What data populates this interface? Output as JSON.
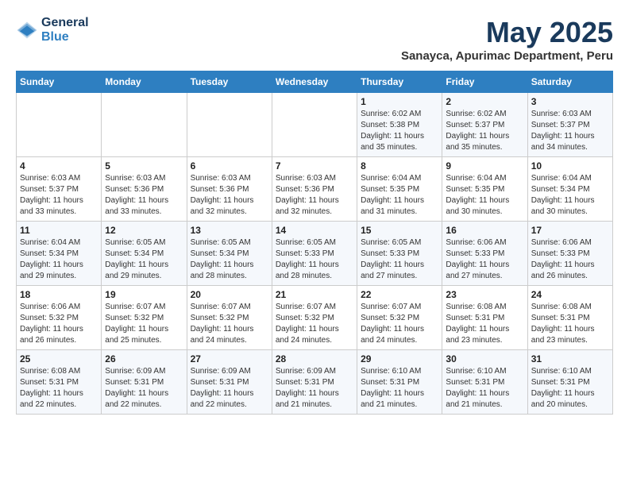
{
  "logo": {
    "line1": "General",
    "line2": "Blue"
  },
  "title": "May 2025",
  "subtitle": "Sanayca, Apurimac Department, Peru",
  "days_of_week": [
    "Sunday",
    "Monday",
    "Tuesday",
    "Wednesday",
    "Thursday",
    "Friday",
    "Saturday"
  ],
  "weeks": [
    [
      {
        "day": "",
        "info": ""
      },
      {
        "day": "",
        "info": ""
      },
      {
        "day": "",
        "info": ""
      },
      {
        "day": "",
        "info": ""
      },
      {
        "day": "1",
        "info": "Sunrise: 6:02 AM\nSunset: 5:38 PM\nDaylight: 11 hours\nand 35 minutes."
      },
      {
        "day": "2",
        "info": "Sunrise: 6:02 AM\nSunset: 5:37 PM\nDaylight: 11 hours\nand 35 minutes."
      },
      {
        "day": "3",
        "info": "Sunrise: 6:03 AM\nSunset: 5:37 PM\nDaylight: 11 hours\nand 34 minutes."
      }
    ],
    [
      {
        "day": "4",
        "info": "Sunrise: 6:03 AM\nSunset: 5:37 PM\nDaylight: 11 hours\nand 33 minutes."
      },
      {
        "day": "5",
        "info": "Sunrise: 6:03 AM\nSunset: 5:36 PM\nDaylight: 11 hours\nand 33 minutes."
      },
      {
        "day": "6",
        "info": "Sunrise: 6:03 AM\nSunset: 5:36 PM\nDaylight: 11 hours\nand 32 minutes."
      },
      {
        "day": "7",
        "info": "Sunrise: 6:03 AM\nSunset: 5:36 PM\nDaylight: 11 hours\nand 32 minutes."
      },
      {
        "day": "8",
        "info": "Sunrise: 6:04 AM\nSunset: 5:35 PM\nDaylight: 11 hours\nand 31 minutes."
      },
      {
        "day": "9",
        "info": "Sunrise: 6:04 AM\nSunset: 5:35 PM\nDaylight: 11 hours\nand 30 minutes."
      },
      {
        "day": "10",
        "info": "Sunrise: 6:04 AM\nSunset: 5:34 PM\nDaylight: 11 hours\nand 30 minutes."
      }
    ],
    [
      {
        "day": "11",
        "info": "Sunrise: 6:04 AM\nSunset: 5:34 PM\nDaylight: 11 hours\nand 29 minutes."
      },
      {
        "day": "12",
        "info": "Sunrise: 6:05 AM\nSunset: 5:34 PM\nDaylight: 11 hours\nand 29 minutes."
      },
      {
        "day": "13",
        "info": "Sunrise: 6:05 AM\nSunset: 5:34 PM\nDaylight: 11 hours\nand 28 minutes."
      },
      {
        "day": "14",
        "info": "Sunrise: 6:05 AM\nSunset: 5:33 PM\nDaylight: 11 hours\nand 28 minutes."
      },
      {
        "day": "15",
        "info": "Sunrise: 6:05 AM\nSunset: 5:33 PM\nDaylight: 11 hours\nand 27 minutes."
      },
      {
        "day": "16",
        "info": "Sunrise: 6:06 AM\nSunset: 5:33 PM\nDaylight: 11 hours\nand 27 minutes."
      },
      {
        "day": "17",
        "info": "Sunrise: 6:06 AM\nSunset: 5:33 PM\nDaylight: 11 hours\nand 26 minutes."
      }
    ],
    [
      {
        "day": "18",
        "info": "Sunrise: 6:06 AM\nSunset: 5:32 PM\nDaylight: 11 hours\nand 26 minutes."
      },
      {
        "day": "19",
        "info": "Sunrise: 6:07 AM\nSunset: 5:32 PM\nDaylight: 11 hours\nand 25 minutes."
      },
      {
        "day": "20",
        "info": "Sunrise: 6:07 AM\nSunset: 5:32 PM\nDaylight: 11 hours\nand 24 minutes."
      },
      {
        "day": "21",
        "info": "Sunrise: 6:07 AM\nSunset: 5:32 PM\nDaylight: 11 hours\nand 24 minutes."
      },
      {
        "day": "22",
        "info": "Sunrise: 6:07 AM\nSunset: 5:32 PM\nDaylight: 11 hours\nand 24 minutes."
      },
      {
        "day": "23",
        "info": "Sunrise: 6:08 AM\nSunset: 5:31 PM\nDaylight: 11 hours\nand 23 minutes."
      },
      {
        "day": "24",
        "info": "Sunrise: 6:08 AM\nSunset: 5:31 PM\nDaylight: 11 hours\nand 23 minutes."
      }
    ],
    [
      {
        "day": "25",
        "info": "Sunrise: 6:08 AM\nSunset: 5:31 PM\nDaylight: 11 hours\nand 22 minutes."
      },
      {
        "day": "26",
        "info": "Sunrise: 6:09 AM\nSunset: 5:31 PM\nDaylight: 11 hours\nand 22 minutes."
      },
      {
        "day": "27",
        "info": "Sunrise: 6:09 AM\nSunset: 5:31 PM\nDaylight: 11 hours\nand 22 minutes."
      },
      {
        "day": "28",
        "info": "Sunrise: 6:09 AM\nSunset: 5:31 PM\nDaylight: 11 hours\nand 21 minutes."
      },
      {
        "day": "29",
        "info": "Sunrise: 6:10 AM\nSunset: 5:31 PM\nDaylight: 11 hours\nand 21 minutes."
      },
      {
        "day": "30",
        "info": "Sunrise: 6:10 AM\nSunset: 5:31 PM\nDaylight: 11 hours\nand 21 minutes."
      },
      {
        "day": "31",
        "info": "Sunrise: 6:10 AM\nSunset: 5:31 PM\nDaylight: 11 hours\nand 20 minutes."
      }
    ]
  ]
}
